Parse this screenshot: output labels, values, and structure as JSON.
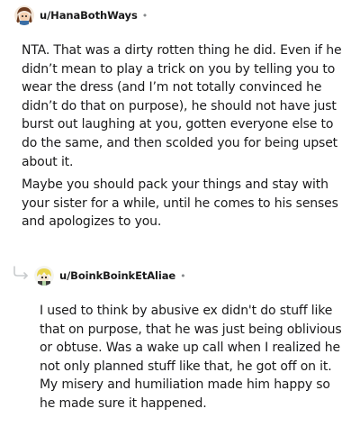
{
  "comments": [
    {
      "username": "u/HanaBothWays",
      "separator": "•",
      "avatar_icon": "user-avatar-icon",
      "paragraphs": [
        "NTA. That was a dirty rotten thing he did. Even if he didn’t mean to play a trick on you by telling you to wear the dress (and I’m not totally convinced he didn’t do that on purpose), he should not have just burst out laughing at you, gotten everyone else to do the same, and then scolded you for being upset about it.",
        "Maybe you should pack your things and stay with your sister for a while, until he comes to his senses and apologizes to you."
      ]
    },
    {
      "username": "u/BoinkBoinkEtAliae",
      "separator": "•",
      "avatar_icon": "user-avatar-icon",
      "reply_icon": "reply-arrow-icon",
      "paragraphs": [
        "I used to think by abusive ex didn't do stuff like that on purpose, that he was just being oblivious or obtuse. Was a wake up call when I realized he not only planned stuff like that, he got off on it. My misery and humiliation made him happy so he made sure it happened."
      ]
    }
  ]
}
